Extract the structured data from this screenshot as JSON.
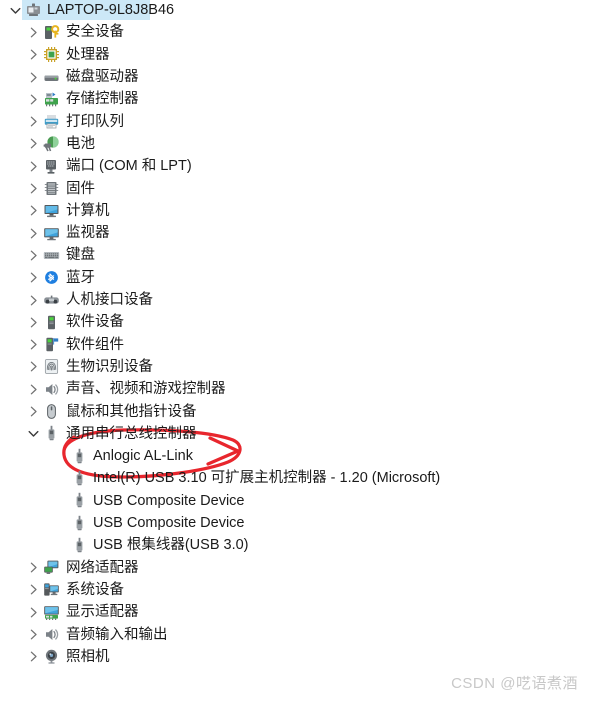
{
  "window": {
    "app": "Device Manager",
    "accent_selection_color": "#cce8f7",
    "annotation_color": "#e8262d"
  },
  "tree": {
    "root": {
      "label": "LAPTOP-9L8J8B46",
      "icon": "computer-node-icon",
      "expanded": true,
      "selected": true
    },
    "items": [
      {
        "label": "安全设备",
        "icon": "security-device-icon",
        "depth": 1,
        "state": "collapsed"
      },
      {
        "label": "处理器",
        "icon": "processor-icon",
        "depth": 1,
        "state": "collapsed"
      },
      {
        "label": "磁盘驱动器",
        "icon": "disk-drive-icon",
        "depth": 1,
        "state": "collapsed"
      },
      {
        "label": "存储控制器",
        "icon": "storage-controller-icon",
        "depth": 1,
        "state": "collapsed"
      },
      {
        "label": "打印队列",
        "icon": "print-queue-icon",
        "depth": 1,
        "state": "collapsed"
      },
      {
        "label": "电池",
        "icon": "battery-icon",
        "depth": 1,
        "state": "collapsed"
      },
      {
        "label": "端口 (COM 和 LPT)",
        "icon": "ports-icon",
        "depth": 1,
        "state": "collapsed"
      },
      {
        "label": "固件",
        "icon": "firmware-icon",
        "depth": 1,
        "state": "collapsed"
      },
      {
        "label": "计算机",
        "icon": "computer-icon",
        "depth": 1,
        "state": "collapsed"
      },
      {
        "label": "监视器",
        "icon": "monitor-icon",
        "depth": 1,
        "state": "collapsed"
      },
      {
        "label": "键盘",
        "icon": "keyboard-icon",
        "depth": 1,
        "state": "collapsed"
      },
      {
        "label": "蓝牙",
        "icon": "bluetooth-icon",
        "depth": 1,
        "state": "collapsed"
      },
      {
        "label": "人机接口设备",
        "icon": "hid-icon",
        "depth": 1,
        "state": "collapsed"
      },
      {
        "label": "软件设备",
        "icon": "software-device-icon",
        "depth": 1,
        "state": "collapsed"
      },
      {
        "label": "软件组件",
        "icon": "software-component-icon",
        "depth": 1,
        "state": "collapsed"
      },
      {
        "label": "生物识别设备",
        "icon": "biometric-icon",
        "depth": 1,
        "state": "collapsed"
      },
      {
        "label": "声音、视频和游戏控制器",
        "icon": "sound-video-game-icon",
        "depth": 1,
        "state": "collapsed"
      },
      {
        "label": "鼠标和其他指针设备",
        "icon": "mouse-icon",
        "depth": 1,
        "state": "collapsed"
      },
      {
        "label": "通用串行总线控制器",
        "icon": "usb-controller-icon",
        "depth": 1,
        "state": "expanded"
      },
      {
        "label": "Anlogic AL-Link",
        "icon": "usb-device-icon",
        "depth": 2,
        "state": "leaf",
        "annotated": true
      },
      {
        "label": "Intel(R) USB 3.10 可扩展主机控制器 - 1.20 (Microsoft)",
        "icon": "usb-device-icon",
        "depth": 2,
        "state": "leaf"
      },
      {
        "label": "USB Composite Device",
        "icon": "usb-device-icon",
        "depth": 2,
        "state": "leaf"
      },
      {
        "label": "USB Composite Device",
        "icon": "usb-device-icon",
        "depth": 2,
        "state": "leaf"
      },
      {
        "label": "USB 根集线器(USB 3.0)",
        "icon": "usb-device-icon",
        "depth": 2,
        "state": "leaf"
      },
      {
        "label": "网络适配器",
        "icon": "network-adapter-icon",
        "depth": 1,
        "state": "collapsed"
      },
      {
        "label": "系统设备",
        "icon": "system-device-icon",
        "depth": 1,
        "state": "collapsed"
      },
      {
        "label": "显示适配器",
        "icon": "display-adapter-icon",
        "depth": 1,
        "state": "collapsed"
      },
      {
        "label": "音频输入和输出",
        "icon": "audio-io-icon",
        "depth": 1,
        "state": "collapsed"
      },
      {
        "label": "照相机",
        "icon": "camera-icon",
        "depth": 1,
        "state": "collapsed"
      }
    ]
  },
  "annotation": {
    "shape": "red-ellipse",
    "target_label": "Anlogic AL-Link"
  },
  "watermark": {
    "text": "CSDN @呓语煮酒"
  }
}
